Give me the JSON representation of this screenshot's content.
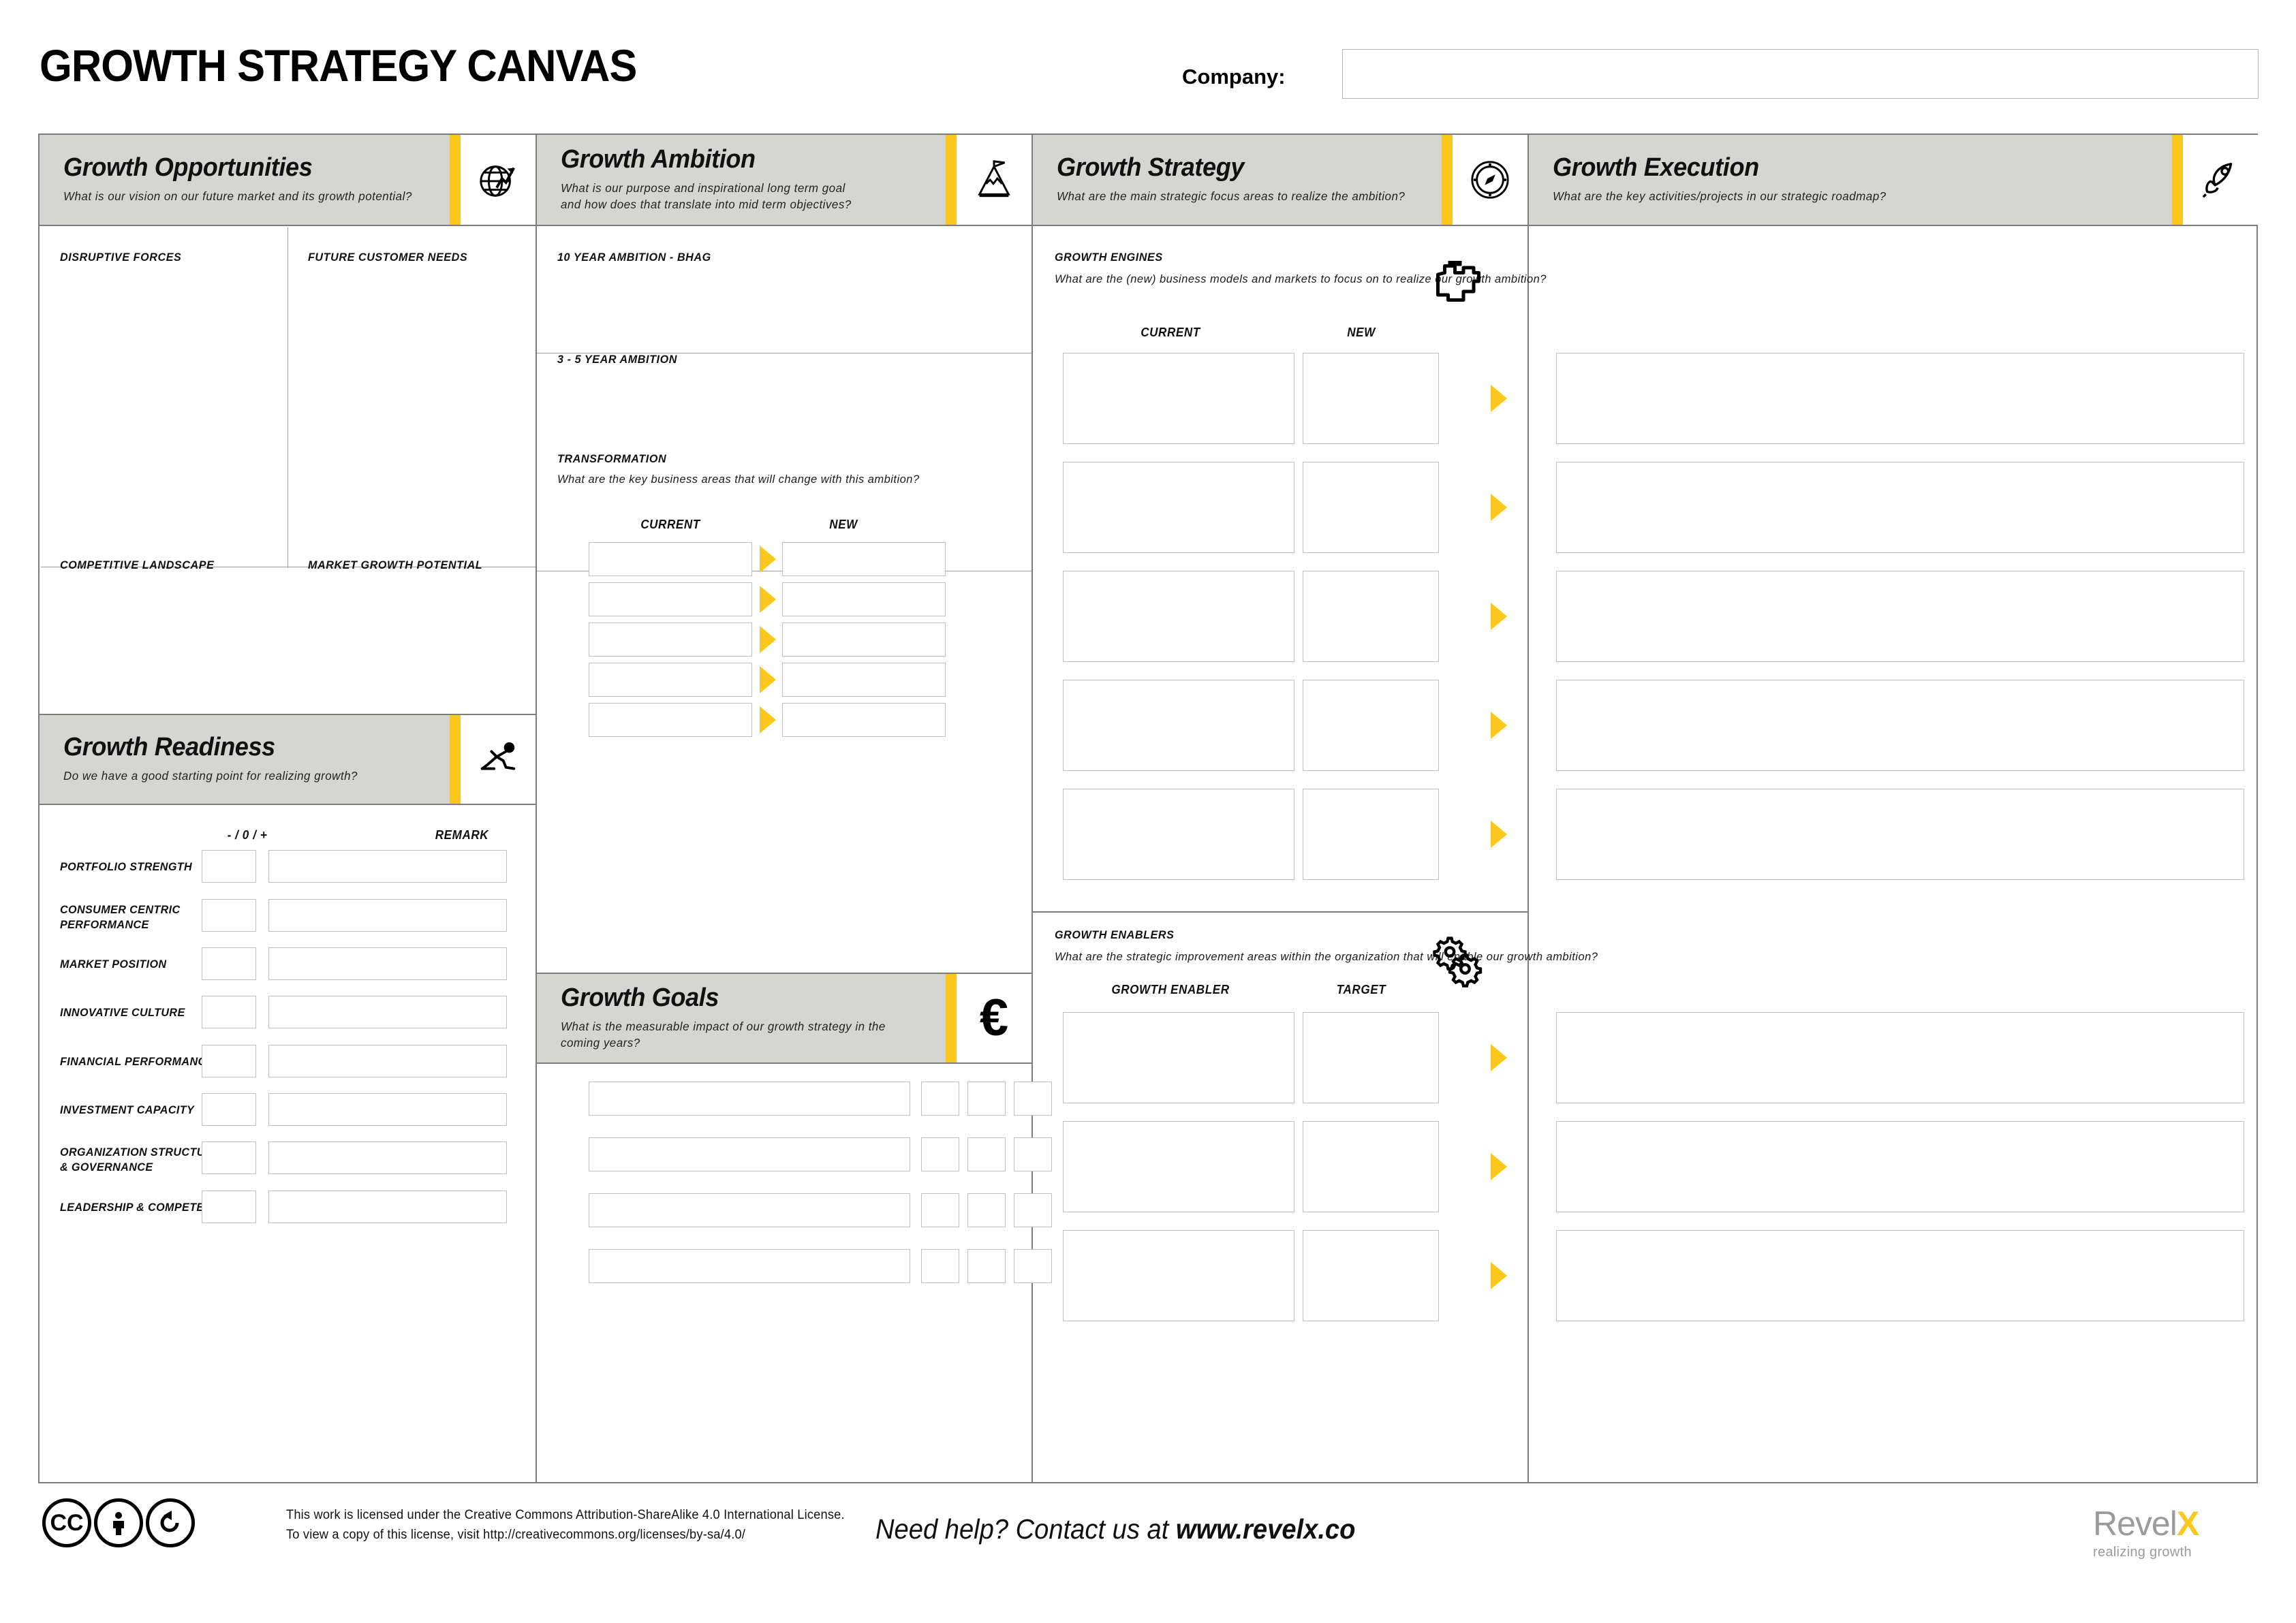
{
  "header": {
    "title": "GROWTH STRATEGY CANVAS",
    "company_label": "Company:",
    "company_value": "",
    "company_placeholder": ""
  },
  "colors": {
    "accent_yellow": "#FDC81E",
    "band_gray": "#d5d5d2",
    "border_gray": "#7d7d7d",
    "box_border": "#bfbfbf",
    "logo_gray": "#9b9b9b"
  },
  "sections": {
    "opportunities": {
      "title": "Growth Opportunities",
      "question": "What is our vision on our future market and its growth potential?",
      "icon": "globe-growth-icon",
      "quadrants": [
        "DISRUPTIVE  FORCES",
        "FUTURE CUSTOMER NEEDS",
        "COMPETITIVE  LANDSCAPE",
        "MARKET GROWTH  POTENTIAL"
      ]
    },
    "readiness": {
      "title": "Growth Readiness",
      "question": "Do  we  have  a  good  starting  point  for  realizing  growth?",
      "icon": "runner-icon",
      "col_score": "- / 0 / +",
      "col_remark": "REMARK",
      "rows": [
        "PORTFOLIO STRENGTH",
        "CONSUMER  CENTRIC\nPERFORMANCE",
        "MARKET POSITION",
        "INNOVATIVE CULTURE",
        "FINANCIAL PERFORMANCE",
        "INVESTMENT CAPACITY",
        "ORGANIZATION STRUCTURE\n& GOVERNANCE",
        "LEADERSHIP & COMPETENCES"
      ]
    },
    "ambition": {
      "title": "Growth Ambition",
      "question": "What is our purpose and inspirational long term goal\nand how does that translate into mid term objectives?",
      "icon": "mountain-flag-icon",
      "bhag_label": "10 YEAR AMBITION - BHAG",
      "midterm_label": "3 - 5 YEAR AMBITION",
      "transformation_label": "TRANSFORMATION",
      "transformation_question": "What are the key business areas that will change with this ambition?",
      "col_current": "CURRENT",
      "col_new": "NEW",
      "row_count": 5
    },
    "goals": {
      "title": "Growth Goals",
      "question": "What is the measurable impact of our growth strategy in the\ncoming years?",
      "icon": "euro-icon",
      "row_count": 4,
      "small_cols": 3
    },
    "strategy": {
      "title": "Growth Strategy",
      "question": "What are the main strategic focus areas to realize the ambition?",
      "icon": "compass-icon",
      "engines": {
        "label": "GROWTH  ENGINES",
        "question": "What are the (new) business models and markets to focus on to\nrealize our growth ambition?",
        "icon": "engine-icon",
        "col_current": "CURRENT",
        "col_new": "NEW",
        "row_count": 5
      },
      "enablers": {
        "label": "GROWTH  ENABLERS",
        "question": "What are the strategic improvement areas within the organization\nthat will enable our growth ambition?",
        "icon": "gears-icon",
        "col_enabler": "GROWTH ENABLER",
        "col_target": "TARGET",
        "row_count": 3
      }
    },
    "execution": {
      "title": "Growth Execution",
      "question": "What are the key activities/projects in our strategic roadmap?",
      "icon": "rocket-icon",
      "top_row_count": 5,
      "bottom_row_count": 3
    }
  },
  "footer": {
    "cc_icons": [
      "cc-icon",
      "by-person-icon",
      "share-alike-icon"
    ],
    "license_line1": "This work is licensed under the Creative Commons Attribution-ShareAlike 4.0 International License.",
    "license_line2": "To view a copy of this license, visit http://creativecommons.org/licenses/by-sa/4.0/",
    "contact_prefix": "Need help? Contact us at ",
    "contact_url": "www.revelx.co",
    "logo_text": "Revel",
    "logo_x": "X",
    "logo_tagline": "realizing growth"
  }
}
